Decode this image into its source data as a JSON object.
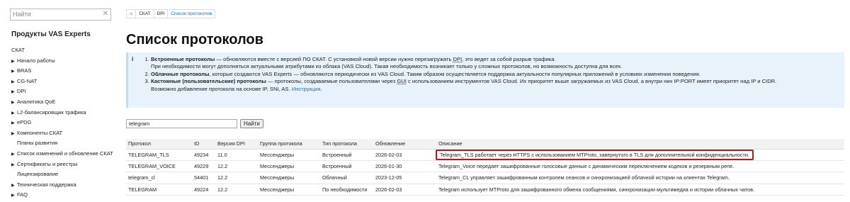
{
  "search": {
    "placeholder": "Найти",
    "clear": "✕"
  },
  "sidebar": {
    "title": "Продукты VAS Experts",
    "items": [
      {
        "label": "СКАТ",
        "expandable": false,
        "level": 0
      },
      {
        "label": "Начало работы",
        "expandable": true,
        "level": 1
      },
      {
        "label": "BRAS",
        "expandable": true,
        "level": 1
      },
      {
        "label": "CG-NAT",
        "expandable": true,
        "level": 1
      },
      {
        "label": "DPI",
        "expandable": true,
        "level": 1
      },
      {
        "label": "Аналитика QoE",
        "expandable": true,
        "level": 1
      },
      {
        "label": "L2-балансировщик трафика",
        "expandable": true,
        "level": 1
      },
      {
        "label": "ePDG",
        "expandable": true,
        "level": 1
      },
      {
        "label": "Компоненты СКАТ",
        "expandable": true,
        "level": 1
      },
      {
        "label": "Планы развития",
        "expandable": false,
        "level": 1
      },
      {
        "label": "Список изменений и обновление СКАТ",
        "expandable": true,
        "level": 1
      },
      {
        "label": "Сертификаты и реестры",
        "expandable": true,
        "level": 1
      },
      {
        "label": "Лицензирование",
        "expandable": false,
        "level": 1
      },
      {
        "label": "Техническая поддержка",
        "expandable": true,
        "level": 1
      },
      {
        "label": "FAQ",
        "expandable": true,
        "level": 1
      }
    ]
  },
  "breadcrumbs": [
    "⌂",
    "СКАТ",
    "DPI",
    "Список протоколов"
  ],
  "page_title": "Список протоколов",
  "info": {
    "icon": "i",
    "item1_bold": "Встроенные протоколы",
    "item1_a": " — обновляются вместе с версией ПО СКАТ. С установкой новой версии нужно перезагружать ",
    "item1_dpi": "DPI",
    "item1_b": ", это ведет за собой разрыв трафика.",
    "item1_line2": "При необходимости могут дополняться актуальными атрибутами из облака (VAS Cloud). Такая необходимость возникает только у сложных протоколов, но возможность доступна для всех.",
    "item2_bold": "Облачные протоколы",
    "item2_text": ", которые создаются VAS Experts — обновляются периодически из VAS Cloud. Таким образом осуществляется поддержка актуальности популярных приложений в условиях изменения поведения.",
    "item3_bold": "Кастомные (пользовательские) протоколы",
    "item3_a": " — протоколы, создаваемые пользователями через ",
    "item3_gui": "GUI",
    "item3_b": " с использованием инструментов VAS Cloud. Их приоритет выше загружаемых из VAS Cloud, а внутри них IP:PORT имеет приоритет над IP и CIDR.",
    "item3_line2": "Возможно добавление протокола на основе IP, SNI, AS. ",
    "item3_link": "Инструкция",
    "item3_end": "."
  },
  "filter": {
    "value": "telegram",
    "button": "Найти"
  },
  "table": {
    "headers": [
      "Протокол",
      "ID",
      "Версия DPI",
      "Группа протокола",
      "Тип протокола",
      "Обновление",
      "Описание"
    ],
    "rows": [
      [
        "TELEGRAM_TLS",
        "49234",
        "11.0",
        "Мессенджеры",
        "Встроенный",
        "2026-02-03",
        "Telegram_TLS работает через HTTPS с использованием MTProto, завернутого в TLS для дополнительной конфиденциальности."
      ],
      [
        "TELEGRAM_VOICE",
        "49229",
        "12.2",
        "Мессенджеры",
        "Встроенный",
        "2026-01-30",
        "Telegram_Voice передает зашифрованные голосовые данные с динамическим переключением кодеков и резервным репе."
      ],
      [
        "telegram_cl",
        "54401",
        "12.2",
        "Мессенджеры",
        "Облачный",
        "2023-12-05",
        "Telegram_CL управляет зашифрованным контролем сеансов и синхронизацией облачной истории на клиентах Telegram."
      ],
      [
        "TELEGRAM",
        "49224",
        "12.2",
        "Мессенджеры",
        "По необходимости",
        "2026-02-03",
        "Telegram использует MTProto для зашифрованного обмена сообщениями, синхронизации мультимедиа и истории облачных чатов."
      ]
    ],
    "highlight_color": "#b01c1c"
  }
}
